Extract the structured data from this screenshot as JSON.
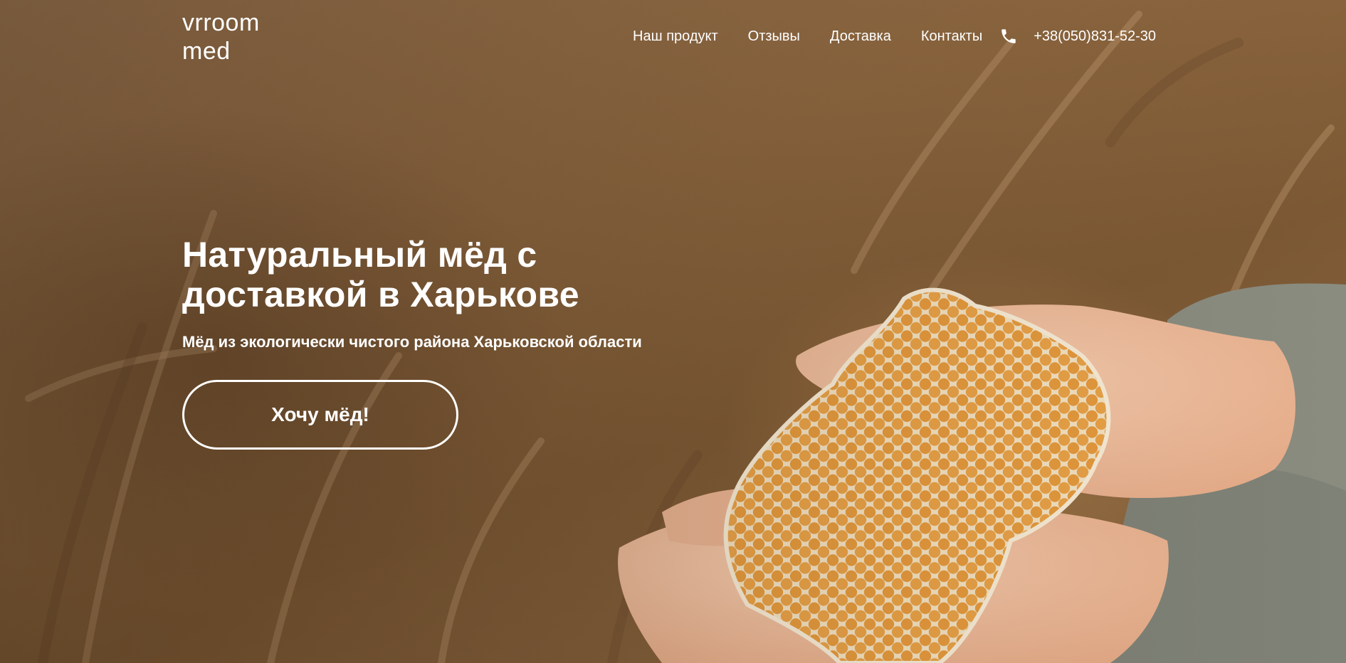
{
  "header": {
    "logo_line1": "vrroom",
    "logo_line2": "med",
    "nav": [
      {
        "label": "Наш продукт"
      },
      {
        "label": "Отзывы"
      },
      {
        "label": "Доставка"
      },
      {
        "label": "Контакты"
      }
    ],
    "phone_icon": "phone-icon",
    "phone": "+38(050)831-52-30"
  },
  "hero": {
    "title_line1": "Натуральный мёд с",
    "title_line2": "доставкой в Харькове",
    "subtitle": "Мёд из экологически чистого района Харьковской области",
    "cta_label": "Хочу мёд!",
    "background_image": "wheat field with hands holding honeycomb"
  },
  "colors": {
    "text": "#ffffff",
    "honey": "#e8a040",
    "field": "#8c663f"
  }
}
